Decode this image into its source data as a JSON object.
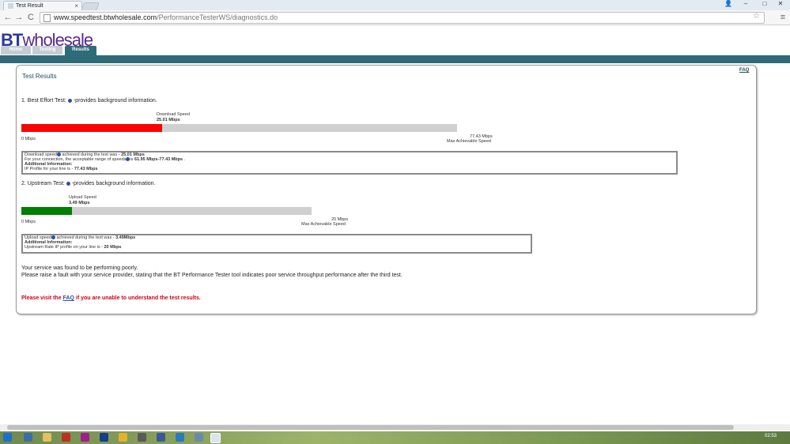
{
  "browser": {
    "tab_title": "Test Result",
    "tab_close": "×",
    "url_host": "www.speedtest.btwholesale.com",
    "url_path": "/PerformanceTesterWS/diagnostics.do",
    "back": "←",
    "forward": "→",
    "reload": "C",
    "star": "☆",
    "menu": "≡",
    "win_minimize": "–",
    "win_maximize": "□",
    "win_close": "✕",
    "user": "👤"
  },
  "site": {
    "logo_bt": "BT",
    "logo_rest": "wholesale",
    "nav": [
      {
        "label": "Home"
      },
      {
        "label": "Testing"
      },
      {
        "label": "Results"
      }
    ],
    "faq_link": "FAQ"
  },
  "results": {
    "title": "Test Results",
    "best_effort": {
      "heading_pre": "1. Best Effort Test:",
      "heading_post": "-provides background information.",
      "speed_label": "Download Speed",
      "speed_value": "25.01 Mbps",
      "min_label": "0 Mbps",
      "max_value": "77.43 Mbps",
      "max_label": "Max Achievable Speed",
      "fill_fraction": 0.323,
      "fill_color": "#ff0000",
      "line1_pre": "Download speed",
      "line1_mid": "achieved during the test was -",
      "line1_val": "25.01 Mbps",
      "line2_pre": "For your connection, the acceptable range of speeds",
      "line2_mid": "is",
      "line2_val": "61.95 Mbps-77.43 Mbps",
      "line2_end": ".",
      "line3": "Additional Information:",
      "line4_pre": "IP Profile for your line is -",
      "line4_val": "77.43 Mbps"
    },
    "upstream": {
      "heading_pre": "2. Upstream Test:",
      "heading_post": "-provides background information.",
      "speed_label": "Upload Speed",
      "speed_value": "3.49 Mbps",
      "min_label": "0 Mbps",
      "max_value": "20 Mbps",
      "max_label": "Max Achievable Speed",
      "fill_fraction": 0.1745,
      "fill_color": "#008000",
      "line1_pre": "Upload speed",
      "line1_mid": "achieved during the test was -",
      "line1_val": "3.49Mbps",
      "line3": "Additional Information:",
      "line4_pre": "Upstream Rate IP profile on your line is -",
      "line4_val": "20 Mbps"
    },
    "summary1": "Your service was found to be performing poorly.",
    "summary2": "Please raise a fault with your service provider, stating that the BT Performance Tester tool indicates poor service throughput performance after the third test.",
    "faq_pre": "Please visit the",
    "faq_link": "FAQ",
    "faq_post": "if you are unable to understand the test results."
  },
  "taskbar": {
    "clock": "02:53"
  }
}
